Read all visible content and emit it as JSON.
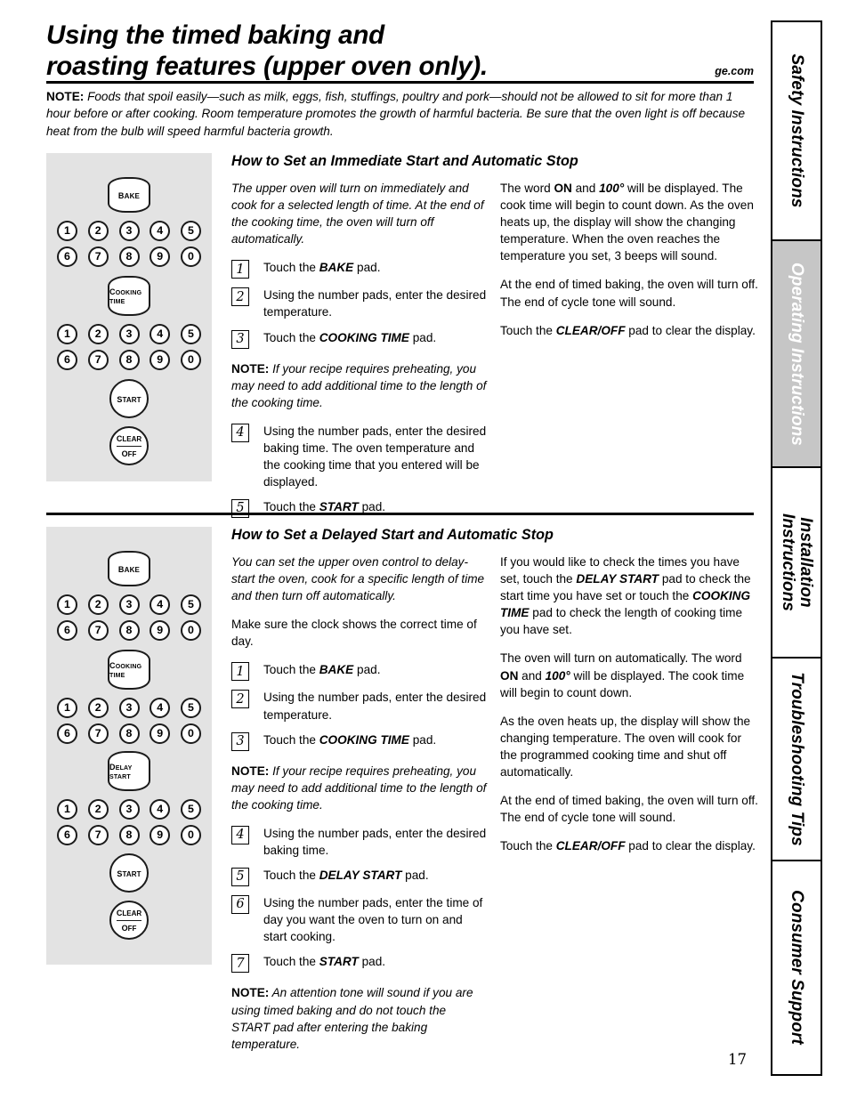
{
  "document": {
    "title_line1": "Using the timed baking and",
    "title_line2": "roasting features (upper oven only).",
    "website": "ge.com",
    "page_number": "17",
    "top_note_label": "NOTE:",
    "top_note_text": " Foods that spoil easily—such as milk, eggs, fish, stuffings, poultry and pork—should not be allowed to sit for more than 1 hour before or after cooking. Room temperature promotes the growth of harmful bacteria. Be sure that the oven light is off because heat from the bulb will speed harmful bacteria growth."
  },
  "sidebar": {
    "tabs": [
      {
        "label": "Safety Instructions",
        "active": false
      },
      {
        "label": "Operating Instructions",
        "active": true
      },
      {
        "label": "Installation\nInstructions",
        "active": false
      },
      {
        "label": "Troubleshooting Tips",
        "active": false
      },
      {
        "label": "Consumer Support",
        "active": false
      }
    ]
  },
  "section1": {
    "heading": "How to Set an Immediate Start and Automatic Stop",
    "panel": {
      "keys": [
        "BAKE",
        "COOKING TIME",
        "START",
        "CLEAR OFF"
      ],
      "numbers_row1": [
        "1",
        "2",
        "3",
        "4",
        "5"
      ],
      "numbers_row2": [
        "6",
        "7",
        "8",
        "9",
        "0"
      ]
    },
    "intro": "The upper oven will turn on immediately and cook for a selected length of time. At the end of the cooking time, the oven will turn off automatically.",
    "steps": [
      {
        "num": "1",
        "pre": "Touch the ",
        "bold": "BAKE",
        "post": " pad."
      },
      {
        "num": "2",
        "pre": "Using the number pads, enter the desired temperature.",
        "bold": "",
        "post": ""
      },
      {
        "num": "3",
        "pre": "Touch the ",
        "bold": "COOKING TIME",
        "post": " pad."
      }
    ],
    "note_label": "NOTE:",
    "note_text": " If your recipe requires preheating, you may need to add additional time to the length of the cooking time.",
    "steps2": [
      {
        "num": "4",
        "pre": "Using the number pads, enter the desired baking time. The oven temperature and the cooking time that you entered will be displayed.",
        "bold": "",
        "post": ""
      },
      {
        "num": "5",
        "pre": "Touch the ",
        "bold": "START",
        "post": " pad."
      }
    ],
    "right": {
      "p1_a": "The word ",
      "p1_on": "ON",
      "p1_b": " and ",
      "p1_temp": "100°",
      "p1_c": " will be displayed. The cook time will begin to count down. As the oven heats up, the display will show the changing temperature. When the oven reaches the temperature you set, 3 beeps will sound.",
      "p2": "At the end of timed baking, the oven will turn off. The end of cycle tone will sound.",
      "p3_a": "Touch the ",
      "p3_pad": "CLEAR/OFF",
      "p3_b": " pad to clear the display."
    }
  },
  "section2": {
    "heading": "How to Set a Delayed Start and Automatic Stop",
    "panel": {
      "keys": [
        "BAKE",
        "COOKING TIME",
        "DELAY START",
        "START",
        "CLEAR OFF"
      ],
      "numbers_row1": [
        "1",
        "2",
        "3",
        "4",
        "5"
      ],
      "numbers_row2": [
        "6",
        "7",
        "8",
        "9",
        "0"
      ]
    },
    "intro": "You can set the upper oven control to delay-start the oven, cook for a specific length of time and then turn off automatically.",
    "clock_note": "Make sure the clock shows the correct time of day.",
    "steps": [
      {
        "num": "1",
        "pre": "Touch the ",
        "bold": "BAKE",
        "post": " pad."
      },
      {
        "num": "2",
        "pre": "Using the number pads, enter the desired temperature.",
        "bold": "",
        "post": ""
      },
      {
        "num": "3",
        "pre": "Touch the ",
        "bold": "COOKING TIME",
        "post": " pad."
      }
    ],
    "note_label": "NOTE:",
    "note_text": " If your recipe requires preheating, you may need to add additional time to the length of the cooking time.",
    "steps2": [
      {
        "num": "4",
        "pre": "Using the number pads, enter the desired baking time.",
        "bold": "",
        "post": ""
      },
      {
        "num": "5",
        "pre": "Touch the ",
        "bold": "DELAY START",
        "post": " pad."
      },
      {
        "num": "6",
        "pre": "Using the number pads, enter the time of day you want the oven to turn on and start cooking.",
        "bold": "",
        "post": ""
      },
      {
        "num": "7",
        "pre": "Touch the ",
        "bold": "START",
        "post": " pad."
      }
    ],
    "note2_label": "NOTE:",
    "note2_text": " An attention tone will sound if you are using timed baking and do not touch the START pad after entering the baking temperature.",
    "right": {
      "p1_a": "If you would like to check the times you have set, touch the ",
      "p1_delay": "DELAY START",
      "p1_b": " pad to check the start time you have set or touch the ",
      "p1_cook": "COOKING TIME",
      "p1_c": " pad to check the length of cooking time you have set.",
      "p2_a": "The oven will turn on automatically. The word ",
      "p2_on": "ON",
      "p2_b": " and ",
      "p2_temp": "100°",
      "p2_c": " will be displayed. The cook time will begin to count down.",
      "p3": "As the oven heats up, the display will show the changing temperature. The oven will cook for the programmed cooking time and shut off automatically.",
      "p4": "At the end of timed baking, the oven will turn off. The end of cycle tone will sound.",
      "p5_a": "Touch the ",
      "p5_pad": "CLEAR/OFF",
      "p5_b": " pad to clear the display."
    }
  }
}
